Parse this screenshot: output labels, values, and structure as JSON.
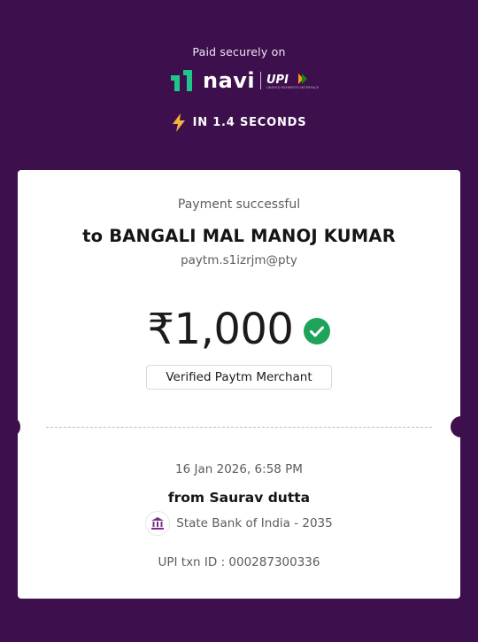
{
  "header": {
    "caption": "Paid securely on",
    "brand_name": "navi",
    "upi_mark": "UPI",
    "upi_tagline": "UNIFIED PAYMENTS INTERFACE",
    "speed_text": "IN 1.4 SECONDS"
  },
  "receipt": {
    "status": "Payment successful",
    "payee": "to BANGALI MAL MANOJ KUMAR",
    "payee_vpa": "paytm.s1izrjm@pty",
    "amount": "₹1,000",
    "merchant_badge": "Verified Paytm Merchant",
    "datetime": "16 Jan 2026, 6:58 PM",
    "payer": "from Saurav  dutta",
    "bank": "State Bank of India - 2035",
    "txn_id": "UPI txn ID : 000287300336"
  },
  "colors": {
    "background": "#3d0f4d",
    "navi_green": "#20c58c",
    "bolt_yellow": "#f6b23a",
    "success_green": "#1ea35a",
    "bank_icon": "#7a2d8a"
  },
  "icons": [
    "navi-logo-icon",
    "upi-logo-icon",
    "lightning-bolt-icon",
    "success-check-icon",
    "bank-building-icon"
  ]
}
